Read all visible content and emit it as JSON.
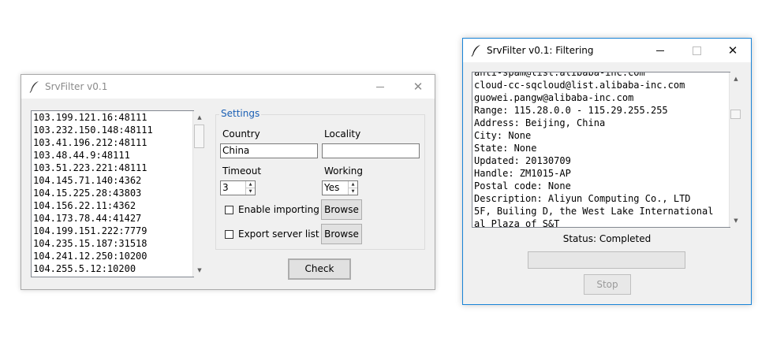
{
  "main_window": {
    "title": "SrvFilter v0.1",
    "server_list": [
      "103.199.121.16:48111",
      "103.232.150.148:48111",
      "103.41.196.212:48111",
      "103.48.44.9:48111",
      "103.51.223.221:48111",
      "104.145.71.140:4362",
      "104.15.225.28:43803",
      "104.156.22.11:4362",
      "104.173.78.44:41427",
      "104.199.151.222:7779",
      "104.235.15.187:31518",
      "104.241.12.250:10200",
      "104.255.5.12:10200"
    ],
    "settings": {
      "group_title": "Settings",
      "country_label": "Country",
      "country_value": "China",
      "locality_label": "Locality",
      "locality_value": "",
      "timeout_label": "Timeout",
      "timeout_value": "3",
      "working_label": "Working",
      "working_value": "Yes",
      "enable_importing_label": "Enable importing",
      "enable_importing_checked": false,
      "export_server_list_label": "Export server list",
      "export_server_list_checked": false,
      "browse_label": "Browse"
    },
    "check_button": "Check"
  },
  "filter_window": {
    "title": "SrvFilter v0.1: Filtering",
    "output_lines": [
      "anti-spam@list.alibaba-inc.com",
      "cloud-cc-sqcloud@list.alibaba-inc.com",
      "guowei.pangw@alibaba-inc.com",
      "Range: 115.28.0.0 - 115.29.255.255",
      "Address: Beijing, China",
      "City: None",
      "State: None",
      "Updated: 20130709",
      "Handle: ZM1015-AP",
      "Postal code: None",
      "Description: Aliyun Computing Co., LTD",
      "5F, Builing D, the West Lake International",
      "al Plaza of S&T"
    ],
    "status_text": "Status: Completed",
    "progress": 0,
    "stop_button": "Stop"
  }
}
